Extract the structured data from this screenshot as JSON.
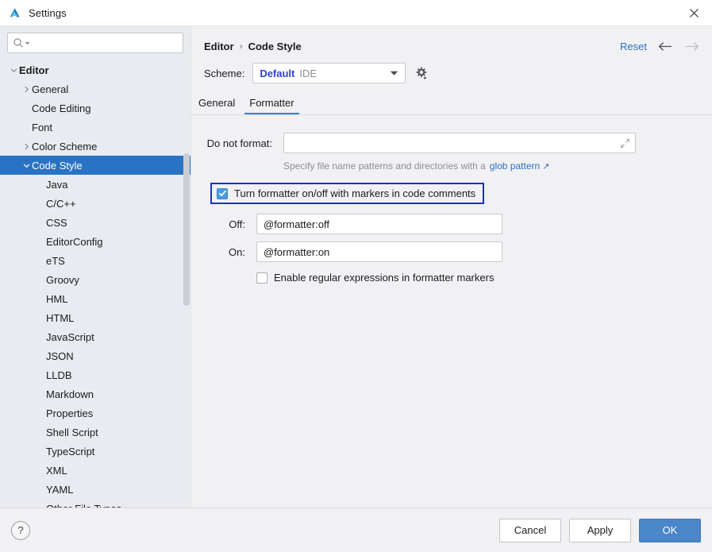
{
  "window": {
    "title": "Settings",
    "logo_icon": "ide-logo-icon",
    "close_icon": "close-icon"
  },
  "sidebar": {
    "search": {
      "placeholder": "",
      "value": "",
      "icon": "search-icon",
      "caret_icon": "chevron-down-icon"
    },
    "items": [
      {
        "label": "Editor",
        "level": 0,
        "arrow": "expanded",
        "bold": true,
        "selected": false
      },
      {
        "label": "General",
        "level": 1,
        "arrow": "collapsed",
        "bold": false,
        "selected": false
      },
      {
        "label": "Code Editing",
        "level": 1,
        "arrow": "none",
        "bold": false,
        "selected": false
      },
      {
        "label": "Font",
        "level": 1,
        "arrow": "none",
        "bold": false,
        "selected": false
      },
      {
        "label": "Color Scheme",
        "level": 1,
        "arrow": "collapsed",
        "bold": false,
        "selected": false
      },
      {
        "label": "Code Style",
        "level": 1,
        "arrow": "expanded",
        "bold": false,
        "selected": true
      },
      {
        "label": "Java",
        "level": 2,
        "arrow": "none",
        "bold": false,
        "selected": false
      },
      {
        "label": "C/C++",
        "level": 2,
        "arrow": "none",
        "bold": false,
        "selected": false
      },
      {
        "label": "CSS",
        "level": 2,
        "arrow": "none",
        "bold": false,
        "selected": false
      },
      {
        "label": "EditorConfig",
        "level": 2,
        "arrow": "none",
        "bold": false,
        "selected": false
      },
      {
        "label": "eTS",
        "level": 2,
        "arrow": "none",
        "bold": false,
        "selected": false
      },
      {
        "label": "Groovy",
        "level": 2,
        "arrow": "none",
        "bold": false,
        "selected": false
      },
      {
        "label": "HML",
        "level": 2,
        "arrow": "none",
        "bold": false,
        "selected": false
      },
      {
        "label": "HTML",
        "level": 2,
        "arrow": "none",
        "bold": false,
        "selected": false
      },
      {
        "label": "JavaScript",
        "level": 2,
        "arrow": "none",
        "bold": false,
        "selected": false
      },
      {
        "label": "JSON",
        "level": 2,
        "arrow": "none",
        "bold": false,
        "selected": false
      },
      {
        "label": "LLDB",
        "level": 2,
        "arrow": "none",
        "bold": false,
        "selected": false
      },
      {
        "label": "Markdown",
        "level": 2,
        "arrow": "none",
        "bold": false,
        "selected": false
      },
      {
        "label": "Properties",
        "level": 2,
        "arrow": "none",
        "bold": false,
        "selected": false
      },
      {
        "label": "Shell Script",
        "level": 2,
        "arrow": "none",
        "bold": false,
        "selected": false
      },
      {
        "label": "TypeScript",
        "level": 2,
        "arrow": "none",
        "bold": false,
        "selected": false
      },
      {
        "label": "XML",
        "level": 2,
        "arrow": "none",
        "bold": false,
        "selected": false
      },
      {
        "label": "YAML",
        "level": 2,
        "arrow": "none",
        "bold": false,
        "selected": false
      },
      {
        "label": "Other File Types",
        "level": 2,
        "arrow": "none",
        "bold": false,
        "selected": false
      }
    ]
  },
  "header": {
    "breadcrumb_root": "Editor",
    "breadcrumb_sep": "›",
    "breadcrumb_leaf": "Code Style",
    "reset_label": "Reset",
    "back_icon": "arrow-left-icon",
    "forward_icon": "arrow-right-icon"
  },
  "scheme": {
    "label": "Scheme:",
    "value": "Default",
    "kind": "IDE",
    "caret_icon": "chevron-down-icon",
    "gear_icon": "gear-icon"
  },
  "tabs": [
    {
      "label": "General",
      "active": false
    },
    {
      "label": "Formatter",
      "active": true
    }
  ],
  "form": {
    "do_not_format": {
      "label": "Do not format:",
      "value": "",
      "placeholder": "",
      "expand_icon": "expand-icon"
    },
    "hint": {
      "text": "Specify file name patterns and directories with a",
      "link": "glob pattern",
      "external_icon": "↗"
    },
    "markers_checkbox": {
      "label": "Turn formatter on/off with markers in code comments",
      "checked": true,
      "focused": true
    },
    "off_field": {
      "label": "Off:",
      "value": "@formatter:off"
    },
    "on_field": {
      "label": "On:",
      "value": "@formatter:on"
    },
    "regex_checkbox": {
      "label": "Enable regular expressions in formatter markers",
      "checked": false
    }
  },
  "footer": {
    "help_label": "?",
    "cancel_label": "Cancel",
    "apply_label": "Apply",
    "ok_label": "OK"
  },
  "colors": {
    "accent_blue": "#2a73c4",
    "link_blue": "#2a6fc4",
    "focus_blue": "#1a2fd6",
    "scheme_blue": "#2f3fcf",
    "ok_button": "#4a86c8",
    "sidebar_bg": "#e8ecf0",
    "panel_bg": "#f1f1f3"
  }
}
